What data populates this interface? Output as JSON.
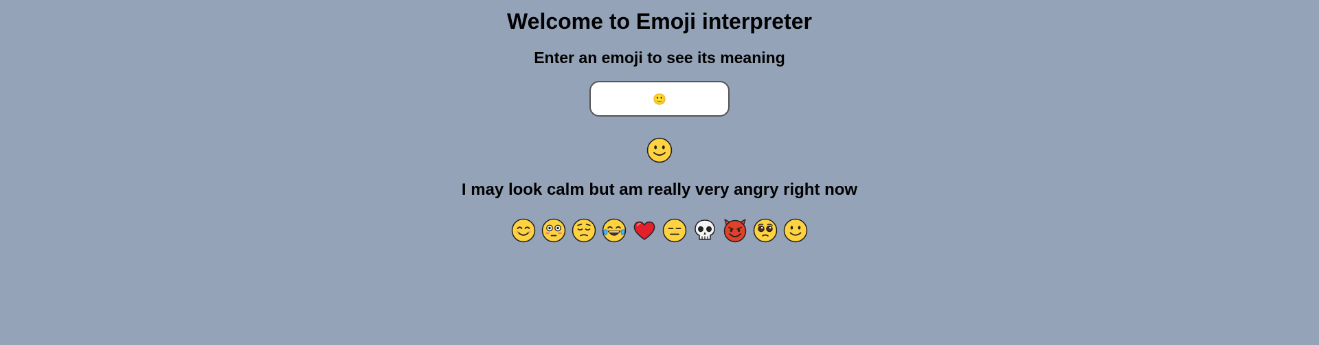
{
  "header": {
    "title": "Welcome to Emoji interpreter",
    "subtitle": "Enter an emoji to see its meaning"
  },
  "input": {
    "value": "🙂",
    "placeholder": ""
  },
  "result": {
    "emoji_icon": "slightly-smiling-face",
    "meaning": "I may look calm but am really very angry right now"
  },
  "emoji_list": [
    {
      "icon": "smiling-face-with-smiling-eyes"
    },
    {
      "icon": "flushed-face"
    },
    {
      "icon": "pensive-face"
    },
    {
      "icon": "face-with-tears-of-joy"
    },
    {
      "icon": "red-heart"
    },
    {
      "icon": "expressionless-face"
    },
    {
      "icon": "skull"
    },
    {
      "icon": "smiling-face-with-horns"
    },
    {
      "icon": "pleading-face"
    },
    {
      "icon": "slightly-smiling-face"
    }
  ],
  "colors": {
    "background": "#94a3b8",
    "emoji_yellow": "#ffd23f",
    "heart_red": "#e3202b",
    "devil_red": "#e0412a"
  }
}
